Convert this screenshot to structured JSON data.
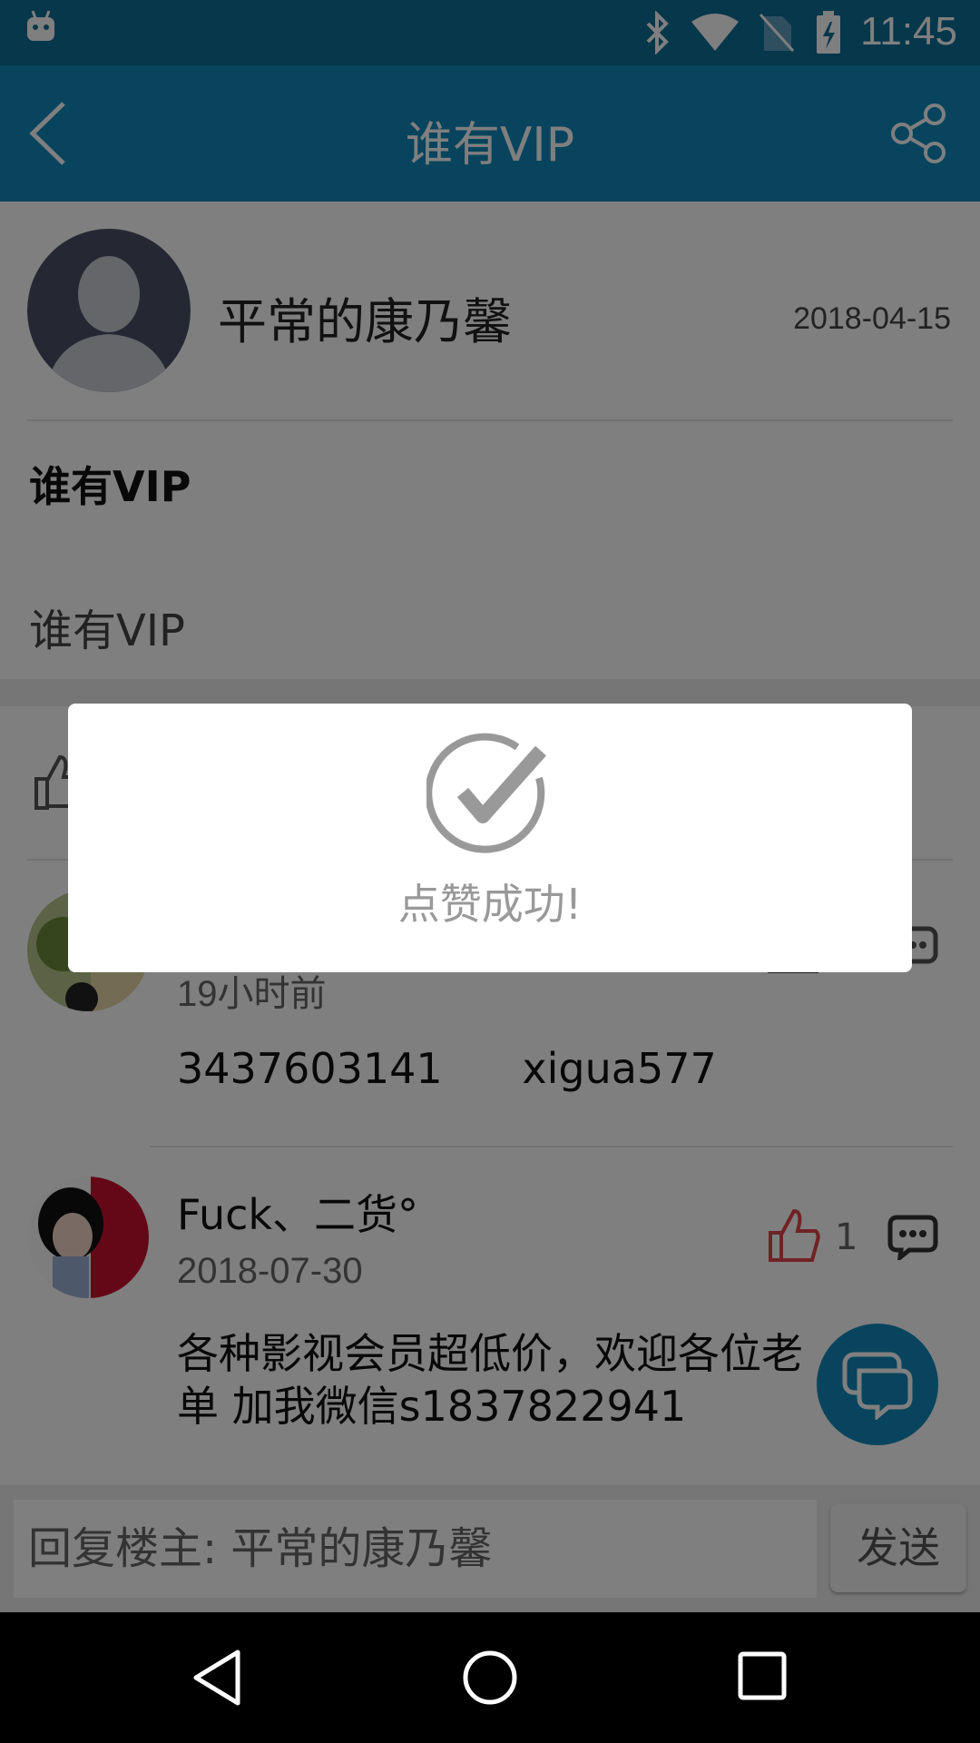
{
  "status_bar": {
    "time": "11:45"
  },
  "app_bar": {
    "title": "谁有VIP",
    "back_icon": "back-arrow-icon",
    "share_icon": "share-icon"
  },
  "post": {
    "author": "平常的康乃馨",
    "date": "2018-04-15",
    "title": "谁有VIP",
    "body": "谁有VIP"
  },
  "comments": [
    {
      "time": "19小时前",
      "text": "3437603141      xigua577"
    },
    {
      "name": "Fuck、二货°",
      "time": "2018-07-30",
      "likes": "1",
      "text_line1": "各种影视会员超低价，欢迎各位老",
      "text_line2": "单 加我微信s1837822941"
    }
  ],
  "reply": {
    "placeholder": "回复楼主: 平常的康乃馨",
    "send_label": "发送"
  },
  "dialog": {
    "message": "点赞成功!"
  },
  "colors": {
    "primary": "#1189ba",
    "status_bar": "#0c6f97",
    "like_red": "#e0454a"
  }
}
